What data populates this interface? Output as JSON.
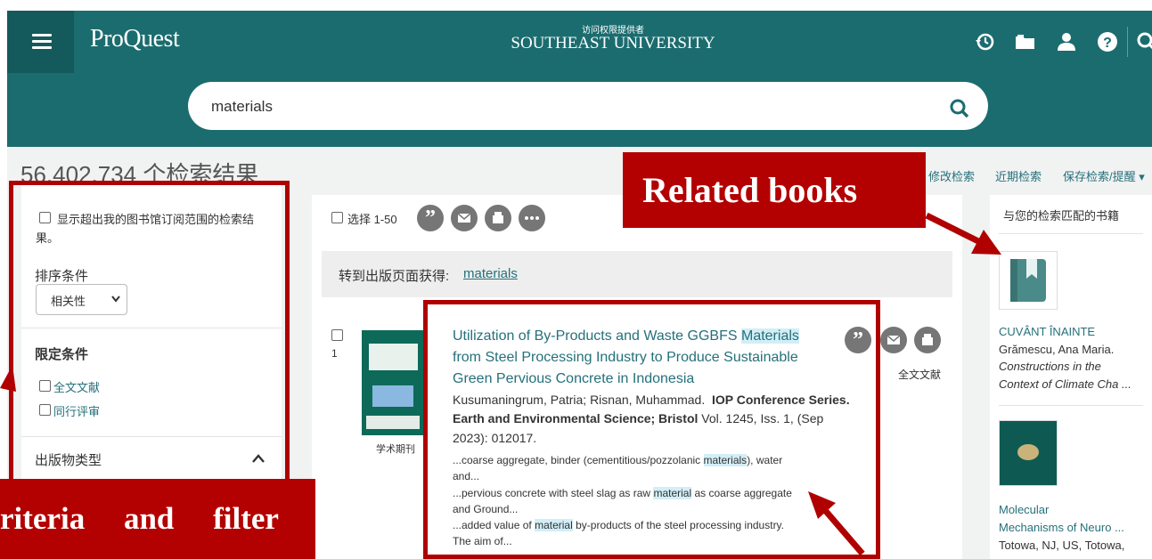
{
  "header": {
    "menu_icon": "hamburger-menu-icon",
    "logo": "ProQuest",
    "provider_caption": "访问权限提供者",
    "provider_name": "SOUTHEAST UNIVERSITY",
    "icons": [
      "history-icon",
      "folder-icon",
      "user-icon",
      "help-icon",
      "search-icon"
    ]
  },
  "search": {
    "query": "materials",
    "submit_icon": "search-icon"
  },
  "results": {
    "count_text": "56,402,734 个检索结果"
  },
  "top_links": {
    "modify": "修改检索",
    "recent": "近期检索",
    "save": "保存检索/提醒 ▾"
  },
  "left_panel": {
    "beyond_label": "显示超出我的图书馆订阅范围的检索结果。",
    "sort_label": "排序条件",
    "sort_selected": "相关性",
    "limit_heading": "限定条件",
    "fulltext": "全文文献",
    "peer_review": "同行评审",
    "pubtype_heading": "出版物类型"
  },
  "main": {
    "select_label": "选择 1-50",
    "goto_label": "转到出版页面获得:",
    "goto_link": "materials"
  },
  "result1": {
    "index": "1",
    "type": "学术期刊",
    "fulltext": "全文文献",
    "title_l1a": "Utilization of By-Products and Waste GGBFS",
    "title_l1b": "Materials",
    "title_l2": "from Steel Processing Industry to Produce Sustainable",
    "title_l3": "Green Pervious Concrete in Indonesia",
    "authors": "Kusumaningrum, Patria; Risnan, Muhammad.",
    "journal_a": "IOP Conference Series.",
    "journal_b": "Earth and Environmental Science; Bristol",
    "vol": "Vol. 1245, Iss. 1,  (Sep",
    "date": "2023): 012017.",
    "s1a": "...coarse aggregate, binder (cementitious/pozzolanic",
    "s1b": "materials",
    "s1c": "), water",
    "s1d": "and...",
    "s2a": "...pervious concrete with steel slag as raw",
    "s2b": "material",
    "s2c": "as coarse aggregate",
    "s2d": "and Ground...",
    "s3a": "...added value of",
    "s3b": "material",
    "s3c": "by-products of the steel processing industry.",
    "s3d": "The aim of..."
  },
  "right_panel": {
    "heading": "与您的检索匹配的书籍",
    "book1_title": "CUVÂNT ÎNAINTE",
    "book1_author": "Grămescu, Ana Maria.",
    "book1_src1": "Constructions in the",
    "book1_src2": "Context of Climate Cha   ...",
    "book2_title1": "Molecular",
    "book2_title2": "Mechanisms of Neuro ...",
    "book2_pub": "Totowa, NJ, US, Totowa,"
  },
  "annotations": {
    "related_books": "Related books",
    "criteria": "riteria     and     filter",
    "color": "#b30000"
  }
}
